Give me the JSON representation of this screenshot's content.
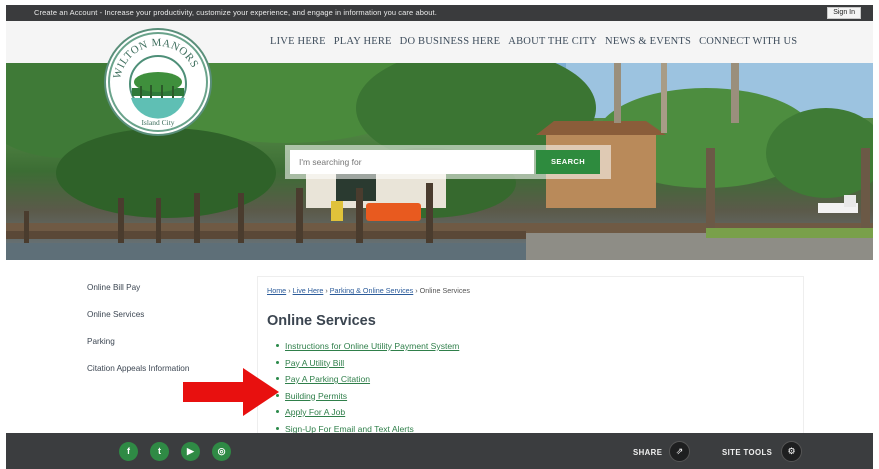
{
  "topbar": {
    "message": "Create an Account - Increase your productivity, customize your experience, and engage in information you care about.",
    "signin_label": "Sign In"
  },
  "logo": {
    "arc_text": "WILTON MANORS",
    "tagline": "Island City"
  },
  "nav": {
    "items": [
      "LIVE HERE",
      "PLAY HERE",
      "DO BUSINESS HERE",
      "ABOUT THE CITY",
      "NEWS & EVENTS",
      "CONNECT WITH US"
    ]
  },
  "search": {
    "placeholder": "I'm searching for",
    "button_label": "SEARCH"
  },
  "sidebar": {
    "items": [
      "Online Bill Pay",
      "Online Services",
      "Parking",
      "Citation Appeals Information"
    ]
  },
  "breadcrumb": {
    "home": "Home",
    "level1": "Live Here",
    "level2": "Parking & Online Services",
    "current": "Online Services",
    "separator": "›"
  },
  "main": {
    "title": "Online Services",
    "links": [
      "Instructions for Online Utility Payment System",
      "Pay A Utility Bill",
      "Pay A Parking Citation",
      "Building Permits",
      "Apply For A Job",
      "Sign-Up For Email and Text Alerts"
    ]
  },
  "footer": {
    "social": [
      {
        "icon": "facebook-icon",
        "glyph": "f"
      },
      {
        "icon": "twitter-icon",
        "glyph": "t"
      },
      {
        "icon": "youtube-icon",
        "glyph": "▶"
      },
      {
        "icon": "instagram-icon",
        "glyph": "◎"
      }
    ],
    "share_label": "SHARE",
    "site_tools_label": "SITE TOOLS"
  },
  "colors": {
    "accent_green": "#2e8b3e",
    "dark_bar": "#3a3b3d",
    "arrow_red": "#e8100f"
  }
}
